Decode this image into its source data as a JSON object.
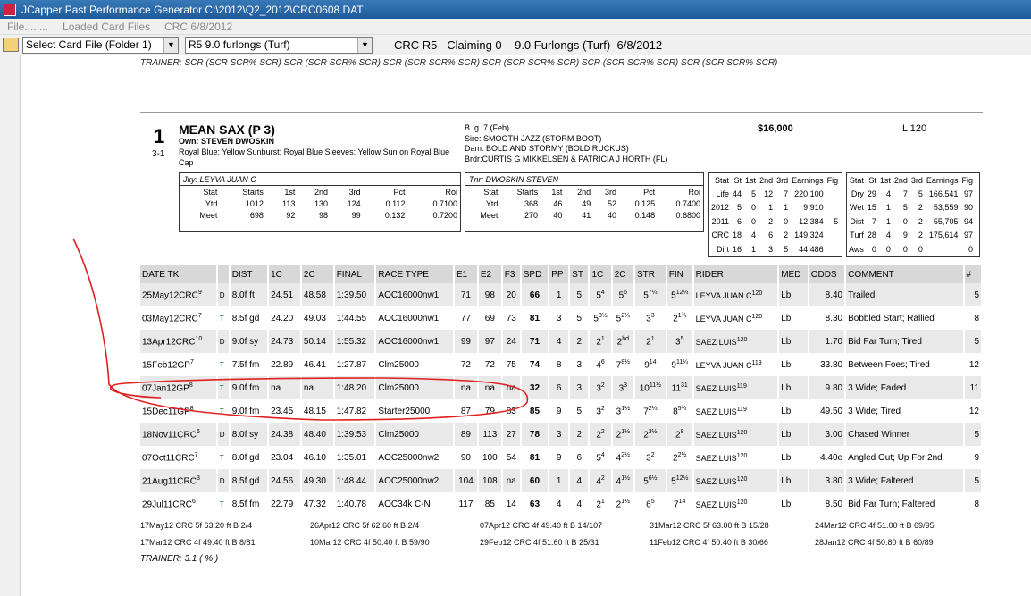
{
  "window": {
    "title": "JCapper Past Performance Generator C:\\2012\\Q2_2012\\CRC0608.DAT"
  },
  "menu": [
    "File........",
    "Loaded Card Files",
    "CRC 6/8/2012"
  ],
  "toolbar": {
    "card_select": "Select Card File (Folder 1)",
    "race_select": "R5 9.0 furlongs (Turf)",
    "info": "CRC R5   Claiming 0    9.0 Furlongs (Turf)  6/8/2012",
    "folder_icon": "folder-icon"
  },
  "trainer_top": "TRAINER: SCR (SCR SCR% SCR)  SCR (SCR SCR% SCR)  SCR (SCR SCR% SCR)  SCR (SCR SCR% SCR)  SCR (SCR SCR% SCR)  SCR (SCR SCR% SCR)",
  "horse": {
    "pgm": "1",
    "odds": "3-1",
    "name": "MEAN SAX  (P 3)",
    "owner": "Own: STEVEN DWOSKIN",
    "silks": "Royal Blue; Yellow Sunburst; Royal Blue Sleeves; Yellow Sun on Royal Blue Cap",
    "bred": "B. g. 7 (Feb)",
    "sire": "Sire: SMOOTH JAZZ (STORM BOOT)",
    "dam": "Dam: BOLD AND STORMY (BOLD RUCKUS)",
    "breeder": "Brdr:CURTIS G MIKKELSEN & PATRICIA J HORTH (FL)",
    "purse": "$16,000",
    "weight": "L 120"
  },
  "jockey": {
    "header": "Jky: LEYVA JUAN C",
    "cols": [
      "Stat",
      "Starts",
      "1st",
      "2nd",
      "3rd",
      "Pct",
      "Roi"
    ],
    "rows": [
      [
        "Ytd",
        "1012",
        "113",
        "130",
        "124",
        "0.112",
        "0.7100"
      ],
      [
        "Meet",
        "698",
        "92",
        "98",
        "99",
        "0.132",
        "0.7200"
      ]
    ]
  },
  "trainer": {
    "header": "Tnr: DWOSKIN STEVEN",
    "cols": [
      "Stat",
      "Starts",
      "1st",
      "2nd",
      "3rd",
      "Pct",
      "Roi"
    ],
    "rows": [
      [
        "Ytd",
        "368",
        "46",
        "49",
        "52",
        "0.125",
        "0.7400"
      ],
      [
        "Meet",
        "270",
        "40",
        "41",
        "40",
        "0.148",
        "0.6800"
      ]
    ]
  },
  "stats1": {
    "cols": [
      "Stat",
      "St",
      "1st",
      "2nd",
      "3rd",
      "Earnings",
      "Fig"
    ],
    "rows": [
      [
        "Life",
        "44",
        "5",
        "12",
        "7",
        "220,100",
        ""
      ],
      [
        "2012",
        "5",
        "0",
        "1",
        "1",
        "9,910",
        ""
      ],
      [
        "2011",
        "6",
        "0",
        "2",
        "0",
        "12,384",
        "5"
      ],
      [
        "CRC",
        "18",
        "4",
        "6",
        "2",
        "149,324",
        ""
      ],
      [
        "Dirt",
        "16",
        "1",
        "3",
        "5",
        "44,486",
        ""
      ]
    ]
  },
  "stats2": {
    "cols": [
      "Stat",
      "St",
      "1st",
      "2nd",
      "3rd",
      "Earnings",
      "Fig"
    ],
    "rows": [
      [
        "Dry",
        "29",
        "4",
        "7",
        "5",
        "166,541",
        "97"
      ],
      [
        "Wet",
        "15",
        "1",
        "5",
        "2",
        "53,559",
        "90"
      ],
      [
        "Dist",
        "7",
        "1",
        "0",
        "2",
        "55,705",
        "94"
      ],
      [
        "Turf",
        "28",
        "4",
        "9",
        "2",
        "175,614",
        "97"
      ],
      [
        "Aws",
        "0",
        "0",
        "0",
        "0",
        "",
        "0"
      ]
    ]
  },
  "pp_cols": [
    "DATE TK",
    "",
    "DIST",
    "1C",
    "2C",
    "FINAL",
    "RACE TYPE",
    "E1",
    "E2",
    "F3",
    "SPD",
    "PP",
    "ST",
    "1C",
    "2C",
    "STR",
    "FIN",
    "RIDER",
    "MED",
    "ODDS",
    "COMMENT",
    "#"
  ],
  "pp_rows": [
    [
      "25May12CRC",
      "9",
      "D",
      "8.0f ft",
      "24.51",
      "48.58",
      "1:39.50",
      "AOC16000nw1",
      "71",
      "98",
      "20",
      "66",
      "1",
      "5",
      "5",
      "4",
      "5",
      "6",
      "5",
      "7¼",
      "5",
      "12¼",
      "LEYVA JUAN C",
      "120",
      "Lb",
      "8.40",
      "Trailed",
      "5"
    ],
    [
      "03May12CRC",
      "7",
      "T",
      "8.5f gd",
      "24.20",
      "49.03",
      "1:44.55",
      "AOC16000nw1",
      "77",
      "69",
      "73",
      "81",
      "3",
      "5",
      "5",
      "3½",
      "5",
      "2¼",
      "3",
      "3",
      "2",
      "1¾",
      "LEYVA JUAN C",
      "120",
      "Lb",
      "8.30",
      "Bobbled Start; Rallied",
      "8"
    ],
    [
      "13Apr12CRC",
      "10",
      "D",
      "9.0f sy",
      "24.73",
      "50.14",
      "1:55.32",
      "AOC16000nw1",
      "99",
      "97",
      "24",
      "71",
      "4",
      "2",
      "2",
      "1",
      "2",
      "hd",
      "2",
      "1",
      "3",
      "5",
      "SAEZ LUIS",
      "120",
      "Lb",
      "1.70",
      "Bid Far Turn; Tired",
      "5"
    ],
    [
      "15Feb12GP",
      "7",
      "T",
      "7.5f fm",
      "22.89",
      "46.41",
      "1:27.87",
      "Clm25000",
      "72",
      "72",
      "75",
      "74",
      "8",
      "3",
      "4",
      "6",
      "7",
      "8½",
      "9",
      "14",
      "9",
      "11¼",
      "LEYVA JUAN C",
      "119",
      "Lb",
      "33.80",
      "Between Foes; Tired",
      "12"
    ],
    [
      "07Jan12GP",
      "8",
      "T",
      "9.0f fm",
      "na",
      "na",
      "1:48.20",
      "Clm25000",
      "na",
      "na",
      "na",
      "32",
      "6",
      "3",
      "3",
      "2",
      "3",
      "3",
      "10",
      "11½",
      "11",
      "31",
      "SAEZ LUIS",
      "119",
      "Lb",
      "9.80",
      "3 Wide; Faded",
      "11"
    ],
    [
      "15Dec11GP",
      "8",
      "T",
      "9.0f fm",
      "23.45",
      "48.15",
      "1:47.82",
      "Starter25000",
      "87",
      "79",
      "83",
      "85",
      "9",
      "5",
      "3",
      "2",
      "3",
      "1½",
      "7",
      "2¼",
      "8",
      "5¾",
      "SAEZ LUIS",
      "119",
      "Lb",
      "49.50",
      "3 Wide; Tired",
      "12"
    ],
    [
      "18Nov11CRC",
      "6",
      "D",
      "8.0f sy",
      "24.38",
      "48.40",
      "1:39.53",
      "Clm25000",
      "89",
      "113",
      "27",
      "78",
      "3",
      "2",
      "2",
      "2",
      "2",
      "1½",
      "2",
      "3½",
      "2",
      "8",
      "SAEZ LUIS",
      "120",
      "Lb",
      "3.00",
      "Chased Winner",
      "5"
    ],
    [
      "07Oct11CRC",
      "7",
      "T",
      "8.0f gd",
      "23.04",
      "46.10",
      "1:35.01",
      "AOC25000nw2",
      "90",
      "100",
      "54",
      "81",
      "9",
      "6",
      "5",
      "4",
      "4",
      "2½",
      "3",
      "2",
      "2",
      "2½",
      "SAEZ LUIS",
      "120",
      "Lb",
      "4.40e",
      "Angled Out; Up For 2nd",
      "9"
    ],
    [
      "21Aug11CRC",
      "3",
      "D",
      "8.5f gd",
      "24.56",
      "49.30",
      "1:48.44",
      "AOC25000nw2",
      "104",
      "108",
      "na",
      "60",
      "1",
      "4",
      "4",
      "2",
      "4",
      "1½",
      "5",
      "6½",
      "5",
      "12½",
      "SAEZ LUIS",
      "120",
      "Lb",
      "3.80",
      "3 Wide; Faltered",
      "5"
    ],
    [
      "29Jul11CRC",
      "6",
      "T",
      "8.5f fm",
      "22.79",
      "47.32",
      "1:40.78",
      "AOC34k C-N",
      "117",
      "85",
      "14",
      "63",
      "4",
      "4",
      "2",
      "1",
      "2",
      "1½",
      "6",
      "5",
      "7",
      "14",
      "SAEZ LUIS",
      "120",
      "Lb",
      "8.50",
      "Bid Far Turn; Faltered",
      "8"
    ]
  ],
  "works": [
    [
      "17May12 CRC 5f 63.20 ft B 2/4",
      "26Apr12 CRC 5f 62.60 ft B 2/4",
      "07Apr12 CRC 4f 49.40 ft B 14/107",
      "31Mar12 CRC 5f 63.00 ft B 15/28",
      "24Mar12 CRC 4f 51.00 ft B 69/95"
    ],
    [
      "17Mar12 CRC 4f 49.40 ft B 8/81",
      "10Mar12 CRC 4f 50.40 ft B 59/90",
      "29Feb12 CRC 4f 51.60 ft B 25/31",
      "11Feb12 CRC 4f 50.40 ft B 30/66",
      "28Jan12 CRC 4f 50.80 ft B 60/89"
    ]
  ],
  "trainer_bottom": "TRAINER: 3.1 ( % )",
  "colors": {
    "annotation": "#e02020",
    "titlebar": "#1d5a99",
    "row_shade": "#e9e9e9",
    "header_shade": "#d8d8d8"
  }
}
